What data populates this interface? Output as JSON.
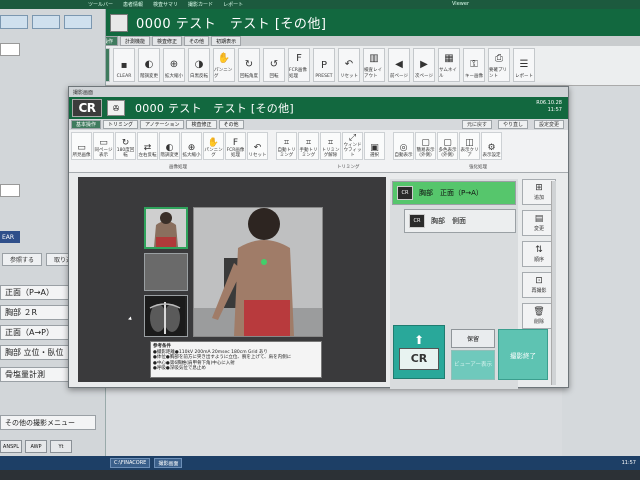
{
  "colors": {
    "header_green": "#12683f",
    "selected_item": "#56c66c",
    "end_button": "#5ec3b2"
  },
  "top_bar": {
    "items": [
      "ツールバー",
      "患者情報",
      "検査サマリ",
      "撮影カード",
      "レポート"
    ],
    "viewer_label": "Viewer"
  },
  "background": {
    "title": "0000 テスト　テスト [その他]",
    "tabs": [
      "基本操作",
      "計測機能",
      "検査修正",
      "その他",
      "初期表示"
    ],
    "ribbon": [
      {
        "label": "",
        "icon": "cursor-icon"
      },
      {
        "label": "CLEAR",
        "icon": "clear-icon"
      },
      {
        "label": "階調変更",
        "icon": "contrast-icon"
      },
      {
        "label": "拡大縮小",
        "icon": "zoom-icon"
      },
      {
        "label": "白黒反転",
        "icon": "invert-icon"
      },
      {
        "label": "パンニング",
        "icon": "hand-icon"
      },
      {
        "label": "回転角度",
        "icon": "rotate-icon"
      },
      {
        "label": "回転",
        "icon": "rotate-icon"
      },
      {
        "label": "FCR画像処理",
        "icon": "fcr-icon"
      },
      {
        "label": "PRESET",
        "icon": "preset-icon"
      },
      {
        "label": "リセット",
        "icon": "undo-icon"
      },
      {
        "label": "検査レイアウト",
        "icon": "layout-icon"
      },
      {
        "label": "前ページ",
        "icon": "prev-icon"
      },
      {
        "label": "次ページ",
        "icon": "next-icon"
      },
      {
        "label": "サムネイル",
        "icon": "thumb-icon"
      },
      {
        "label": "キー画像",
        "icon": "key-icon"
      },
      {
        "label": "要確プリント",
        "icon": "print-icon"
      },
      {
        "label": "レポート",
        "icon": "report-icon"
      }
    ],
    "left_panel": {
      "items": [
        "正面（P→A）",
        "胸部 ２R",
        "正面（A→P）",
        "胸部 立位・臥位",
        "骨塩量計測",
        "その他の撮影メニュー"
      ],
      "small_buttons": [
        "参照する",
        "取り込む"
      ],
      "dark_label": "EAR",
      "lower_buttons": [
        "ANSPL",
        "AWP",
        "Yt"
      ]
    },
    "taskbar": [
      "C:\\FINACORE",
      "撮影画面"
    ],
    "taskbar_clock": "11:57"
  },
  "dialog": {
    "window_title": "撮影画面",
    "logo": "CR",
    "title": "0000 テスト　テスト [その他]",
    "date": "R06.10.28",
    "time": "11:57",
    "tabs": [
      "基本操作",
      "トリミング",
      "アノテーション",
      "検査修正",
      "その他"
    ],
    "tab_right": [
      "元に戻す",
      "やり直し",
      "設定変更"
    ],
    "ribbon": [
      {
        "label": "所見画像",
        "icon": "film-icon"
      },
      {
        "label": "同ページ表示",
        "icon": "page-icon"
      },
      {
        "label": "180度回転",
        "icon": "rotate-icon"
      },
      {
        "label": "左右反転",
        "icon": "flip-icon"
      },
      {
        "label": "階調変更",
        "icon": "contrast-icon"
      },
      {
        "label": "拡大縮小",
        "icon": "zoom-icon"
      },
      {
        "label": "パンニング",
        "icon": "hand-icon"
      },
      {
        "label": "FCR画像処理",
        "icon": "fcr-icon"
      },
      {
        "label": "リセット",
        "icon": "undo-icon"
      },
      {
        "label": "自動トリミング",
        "icon": "trim-icon"
      },
      {
        "label": "手動トリミング",
        "icon": "trim-icon"
      },
      {
        "label": "トリミング解除",
        "icon": "trim-icon"
      },
      {
        "label": "ウィンドウフィット",
        "icon": "fit-icon"
      },
      {
        "label": "選択",
        "icon": "select-icon"
      },
      {
        "label": "自動表示",
        "icon": "auto-icon"
      },
      {
        "label": "簡易表示(外側)",
        "icon": "display-icon"
      },
      {
        "label": "多色表示(外側)",
        "icon": "display-icon"
      },
      {
        "label": "表示クリア",
        "icon": "clear-icon"
      },
      {
        "label": "表示設定",
        "icon": "setting-icon"
      }
    ],
    "group_labels": [
      "画像処理",
      "トリミング",
      "強化処理"
    ],
    "protocols": [
      {
        "label": "胸部　正面（P→A）",
        "selected": true
      },
      {
        "label": "胸部　側面",
        "selected": false
      }
    ],
    "side_buttons": [
      "追加",
      "変更",
      "順序",
      "再撮影",
      "削除"
    ],
    "annotation": {
      "title": "参考条件",
      "lines": [
        "●撮影距離●110kV 200mA 20msec 180cm Grid あり",
        "●体位●胸部を前方に突き出すように立位、腕を上げて、肩を内側に",
        "●中心●第6胸椎(肩甲骨下角)中心に入射",
        "●呼吸●深吸気位で息止め"
      ]
    },
    "buttons": {
      "save": "保留",
      "viewer": "ビューアー表示",
      "end": "撮影終了",
      "cr": "CR"
    }
  }
}
